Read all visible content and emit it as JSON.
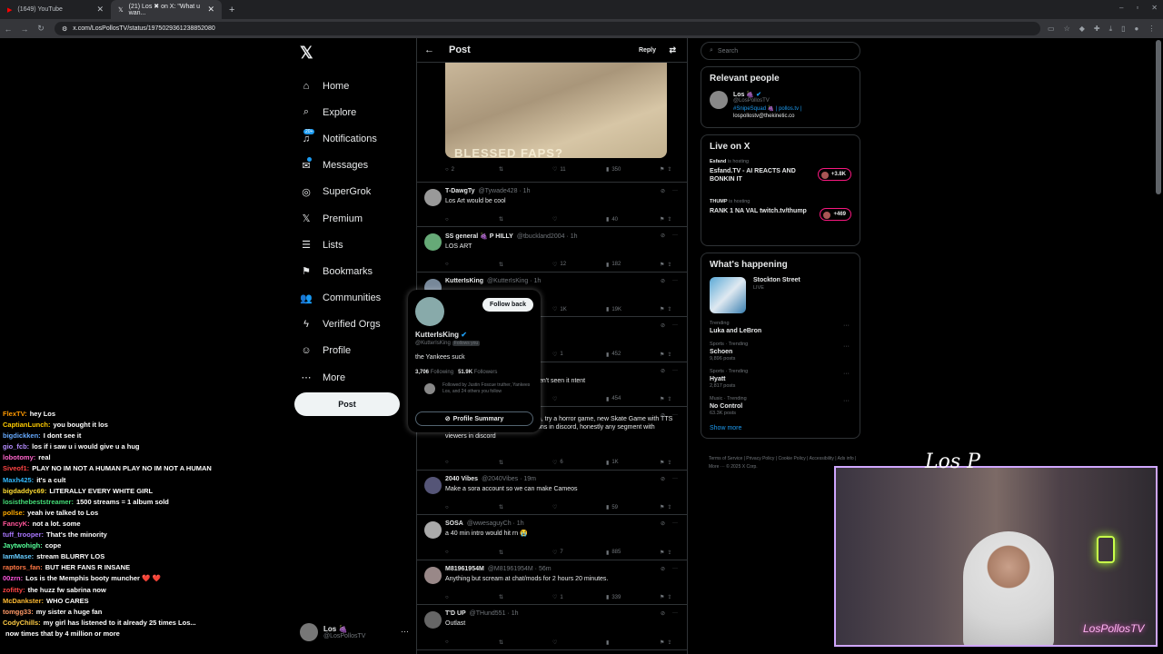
{
  "browser": {
    "tabs": [
      {
        "title": "(1649) YouTube",
        "active": false
      },
      {
        "title": "(21) Los ✖ on X: \"What u wan...",
        "active": true
      }
    ],
    "url": "x.com/LosPollosTV/status/1975029361238852080"
  },
  "nav": {
    "items": [
      {
        "label": "Home",
        "icon": "home-icon"
      },
      {
        "label": "Explore",
        "icon": "search-icon"
      },
      {
        "label": "Notifications",
        "icon": "bell-icon",
        "badge": "20+"
      },
      {
        "label": "Messages",
        "icon": "mail-icon"
      },
      {
        "label": "SuperGrok",
        "icon": "grok-icon"
      },
      {
        "label": "Premium",
        "icon": "x-icon"
      },
      {
        "label": "Lists",
        "icon": "list-icon"
      },
      {
        "label": "Bookmarks",
        "icon": "bookmark-icon"
      },
      {
        "label": "Communities",
        "icon": "people-icon"
      },
      {
        "label": "Verified Orgs",
        "icon": "bolt-icon"
      },
      {
        "label": "Profile",
        "icon": "user-icon"
      },
      {
        "label": "More",
        "icon": "more-icon"
      }
    ],
    "post_label": "Post",
    "account": {
      "name": "Los 🍇",
      "handle": "@LosPollosTV"
    }
  },
  "main": {
    "title": "Post",
    "reply_label": "Reply",
    "image_text": "BLESSED FAPS?",
    "image_actions": {
      "replies": "2",
      "reposts": "",
      "likes": "11",
      "views": "350"
    },
    "replies": [
      {
        "name": "T-DawgTy",
        "handle": "@Tywade428 · 1h",
        "text": "Los Art would be cool",
        "replies": "",
        "reposts": "",
        "likes": "",
        "views": "40"
      },
      {
        "name": "SS general 🍇 P HILLY",
        "handle": "@tbuckland2004 · 1h",
        "text": "LOS ART",
        "replies": "",
        "reposts": "",
        "likes": "12",
        "views": "182"
      },
      {
        "name": "KutterIsKing",
        "handle": "@KutterIsKing · 1h",
        "text": "",
        "replies": "",
        "reposts": "",
        "likes": "1K",
        "views": "19K"
      },
      {
        "name": "",
        "handle": "sManlia · 1h",
        "text": "day 2 nights ago? Or am I trippin",
        "replies": "",
        "reposts": "",
        "likes": "1",
        "views": "452"
      },
      {
        "name": "",
        "handle": "5 · 1h",
        "text": "maybe Raf would be fire. We haven't seen it ntent",
        "replies": "",
        "reposts": "",
        "likes": "",
        "views": "454"
      },
      {
        "name": "",
        "handle": "",
        "text": "Frank calls, Mystery Tech to laugh, try a horror game, new Skate Game with TTS or media share, Viewer Confessions in discord, honestly any segment with viewers in discord",
        "replies": "",
        "reposts": "",
        "likes": "6",
        "views": "1K"
      },
      {
        "name": "2040 Vibes",
        "handle": "@2040Vibes · 19m",
        "text": "Make a sora account so we can make Cameos",
        "replies": "",
        "reposts": "",
        "likes": "",
        "views": "59"
      },
      {
        "name": "SOSA",
        "handle": "@wwesaguyCh · 1h",
        "text": "a 40 min intro would hit rn 😭",
        "replies": "",
        "reposts": "",
        "likes": "7",
        "views": "885"
      },
      {
        "name": "M81961954M",
        "handle": "@M81961954M · 56m",
        "text": "Anything but scream at chat/mods for 2 hours 20 minutes.",
        "replies": "",
        "reposts": "",
        "likes": "1",
        "views": "339"
      },
      {
        "name": "T'D UP",
        "handle": "@THund551 · 1h",
        "text": "Outlast",
        "replies": "",
        "reposts": "",
        "likes": "",
        "views": ""
      }
    ]
  },
  "hovercard": {
    "follow_label": "Follow back",
    "name": "KutterIsKing",
    "handle": "@KutterIsKing",
    "follows_you": "Follows you",
    "bio": "the Yankees suck",
    "following_count": "3,706",
    "following_label": "Following",
    "followers_count": "51.9K",
    "followers_label": "Followers",
    "followed_by": "Followed by Justin Foscue truther, Yankees Los, and 24 others you follow",
    "profile_summary": "Profile Summary"
  },
  "right": {
    "search_placeholder": "Search",
    "relevant_title": "Relevant people",
    "relevant": {
      "name": "Los 🍇",
      "handle": "@LosPollosTV",
      "bio_tag": "#SnipeSquad 🍇 | pollos.tv |",
      "bio_email": "lospollostv@thekinetic.co"
    },
    "live_title": "Live on X",
    "live": [
      {
        "host": "Esfand",
        "host_suffix": "is hosting",
        "title": "Esfand.TV - AI REACTS AND BONKIN IT",
        "count": "+3.8K"
      },
      {
        "host": "THUMP",
        "host_suffix": "is hosting",
        "title": "RANK 1 NA VAL twitch.tv/thump",
        "count": "+469"
      }
    ],
    "happening_title": "What's happening",
    "feature": {
      "title": "Stockton Street",
      "sub": "LIVE"
    },
    "trends": [
      {
        "cat": "Trending",
        "title": "Luka and LeBron",
        "posts": ""
      },
      {
        "cat": "Sports · Trending",
        "title": "Schoen",
        "posts": "9,896 posts"
      },
      {
        "cat": "Sports · Trending",
        "title": "Hyatt",
        "posts": "2,817 posts"
      },
      {
        "cat": "Music · Trending",
        "title": "No Control",
        "posts": "63.3K posts"
      }
    ],
    "show_more": "Show more",
    "footer": "Terms of Service | Privacy Policy | Cookie Policy | Accessibility | Ads info | More ··· © 2025 X Corp."
  },
  "chat": [
    {
      "user": "FlexTV",
      "color": "#ff9900",
      "msg": "hey Los"
    },
    {
      "user": "CaptianLunch",
      "color": "#ffcc00",
      "msg": "you bought it los"
    },
    {
      "user": "bigdickken",
      "color": "#66aaff",
      "msg": "I dont see it"
    },
    {
      "user": "gio_fcb",
      "color": "#b48cff",
      "msg": "los if i saw u i would give u a hug"
    },
    {
      "user": "lobotomy",
      "color": "#ff66cc",
      "msg": "real"
    },
    {
      "user": "Siveof1",
      "color": "#ff4444",
      "msg": "PLAY NO IM NOT A HUMAN PLAY NO IM NOT A HUMAN"
    },
    {
      "user": "Maxh425",
      "color": "#33bbff",
      "msg": "it's a cult"
    },
    {
      "user": "bigdaddyc69",
      "color": "#ffdd33",
      "msg": "LITERALLY EVERY WHITE GIRL"
    },
    {
      "user": "losisthebeststreamer",
      "color": "#44dd77",
      "msg": "1500 streams = 1 album sold"
    },
    {
      "user": "pollse",
      "color": "#ffaa00",
      "msg": "yeah ive talked to Los"
    },
    {
      "user": "FancyK",
      "color": "#ff5599",
      "msg": "not a lot. some"
    },
    {
      "user": "tuff_trooper",
      "color": "#aa77ff",
      "msg": "That's the minority"
    },
    {
      "user": "Jaytwohigh",
      "color": "#55ff99",
      "msg": "cope"
    },
    {
      "user": "IamMase",
      "color": "#66ccff",
      "msg": "stream BLURRY LOS"
    },
    {
      "user": "raptors_fan",
      "color": "#ff7744",
      "msg": "BUT HER FANS R INSANE"
    },
    {
      "user": "00zrn",
      "color": "#ff55dd",
      "msg": "Los is the Memphis booty muncher ❤️ ❤️"
    },
    {
      "user": "zofitty",
      "color": "#ff4444",
      "msg": "the huzz fw sabrina now"
    },
    {
      "user": "McDankster",
      "color": "#ffbb33",
      "msg": "WHO CARES"
    },
    {
      "user": "tomgg33",
      "color": "#ff9966",
      "msg": "my sister a huge fan"
    },
    {
      "user": "CodyChills",
      "color": "#ffcc44",
      "msg": "my girl has listened to it already 25 times Los..."
    },
    {
      "user": "",
      "color": "#ffffff",
      "msg": "now times that by 4 million or more"
    }
  ],
  "overlay": {
    "cam_logo": "Los P",
    "neon": "LosPollosTV"
  }
}
